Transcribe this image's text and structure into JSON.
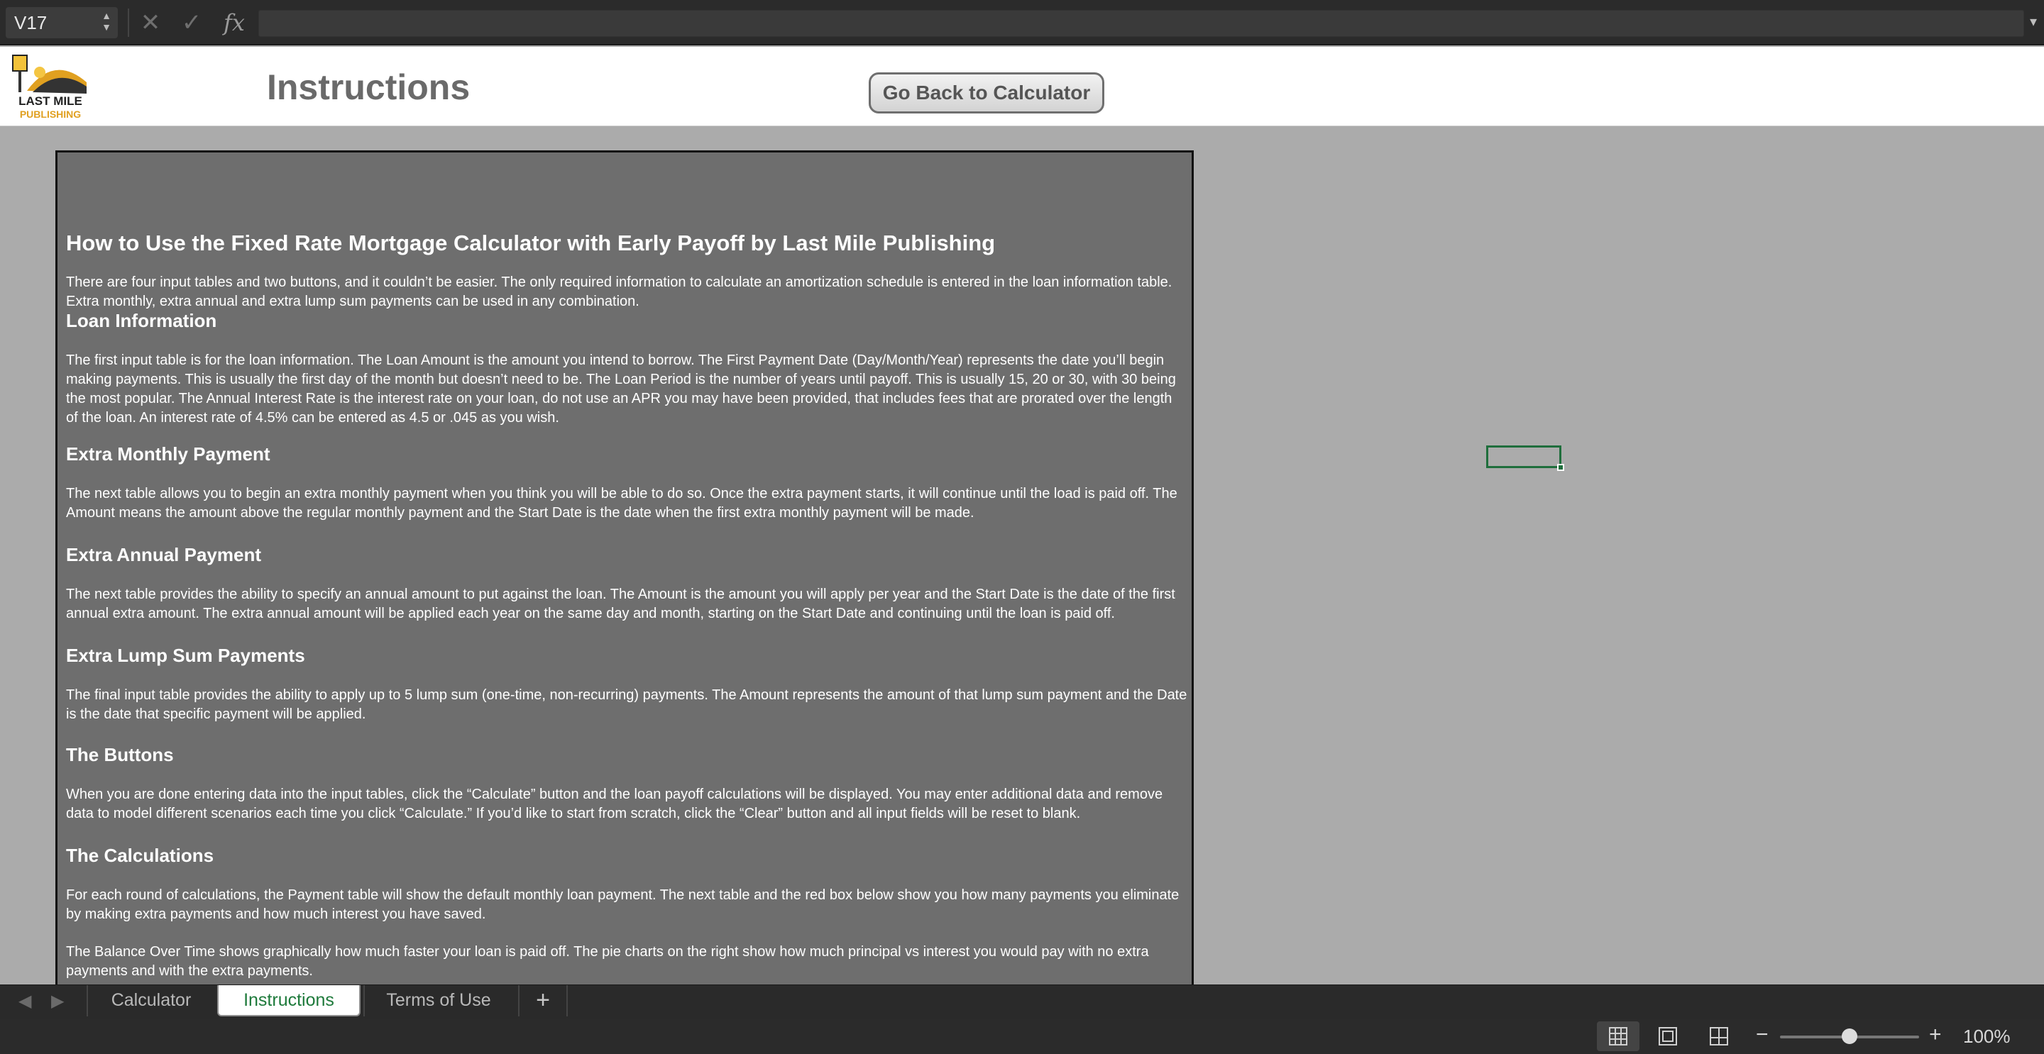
{
  "formula_bar": {
    "cell_reference": "V17",
    "formula_value": "",
    "stepper_up": "▲",
    "stepper_down": "▼",
    "cancel_icon": "✕",
    "enter_icon": "✓",
    "fx_label": "fx",
    "expand_icon": "▾"
  },
  "header": {
    "logo_text_line1": "LAST MILE",
    "logo_text_line2": "PUBLISHING",
    "title": "Instructions",
    "back_button_label": "Go Back to Calculator"
  },
  "instructions": {
    "main_heading": "How to Use the Fixed Rate Mortgage Calculator with Early Payoff by Last Mile Publishing",
    "intro": "There are four input tables and two buttons, and it couldn’t be easier. The only required information to calculate an amortization schedule is entered in the loan information table. Extra monthly, extra annual and extra lump sum payments can be used in any combination.",
    "sections": [
      {
        "heading": "Loan Information",
        "text": "The first input table is for the loan information. The Loan Amount is the amount you intend to borrow. The First Payment Date (Day/Month/Year) represents the date you’ll begin making payments. This is usually the first day of the month but doesn’t need to be. The Loan Period is the number of years until payoff. This is usually 15, 20 or 30, with 30 being the most popular. The Annual Interest Rate is the interest rate on your loan, do not use an APR you may have been provided, that includes fees that are prorated over the length of the loan. An interest rate of 4.5% can be entered as 4.5 or .045 as you wish."
      },
      {
        "heading": "Extra Monthly Payment",
        "text": "The next table allows you to begin an extra monthly payment when you think you will be able to do so. Once the extra payment starts, it will continue until the load is paid off. The Amount means the amount above the regular monthly payment and the Start Date is the date when the first extra monthly payment will be made."
      },
      {
        "heading": "Extra Annual Payment",
        "text": "The next table provides the ability to specify an annual amount to put against the loan. The Amount is the amount you will apply per year and the Start Date is the date of the first annual extra amount. The extra annual amount will be applied each year on the same day and month, starting on the Start Date and continuing until the loan is paid off."
      },
      {
        "heading": "Extra Lump Sum Payments",
        "text": "The final input table provides the ability to apply up to 5 lump sum (one-time, non-recurring) payments. The Amount represents the amount of that lump sum payment and the Date is the date that specific payment will be applied."
      },
      {
        "heading": "The Buttons",
        "text": "When you are done entering data into the input tables, click the “Calculate” button and the loan payoff calculations will be displayed. You may enter additional data and remove data to model different scenarios each time you click “Calculate.” If you’d like to start from scratch, click the “Clear” button and all input fields will be reset to blank."
      },
      {
        "heading": "The Calculations",
        "text": "For each round of calculations, the Payment table will show the default monthly loan payment. The next table and the red box below show you how many payments you eliminate by making extra payments and how much interest you have saved.",
        "text2": "The Balance Over Time shows graphically how much faster your loan is paid off. The pie charts on the right show how much principal vs interest you would pay with no extra payments and with the extra payments."
      }
    ]
  },
  "tabs": {
    "prev_icon": "◀",
    "next_icon": "▶",
    "items": [
      "Calculator",
      "Instructions",
      "Terms of Use"
    ],
    "active_index": 1,
    "add_label": "+"
  },
  "status_bar": {
    "zoom_minus": "−",
    "zoom_plus": "+",
    "zoom_level": "100%",
    "zoom_fraction": 0.5
  },
  "colors": {
    "accent_green": "#1e7a3b",
    "panel_gray": "#6e6e6e",
    "sheet_gray": "#ababab",
    "logo_gold": "#e0a020"
  }
}
